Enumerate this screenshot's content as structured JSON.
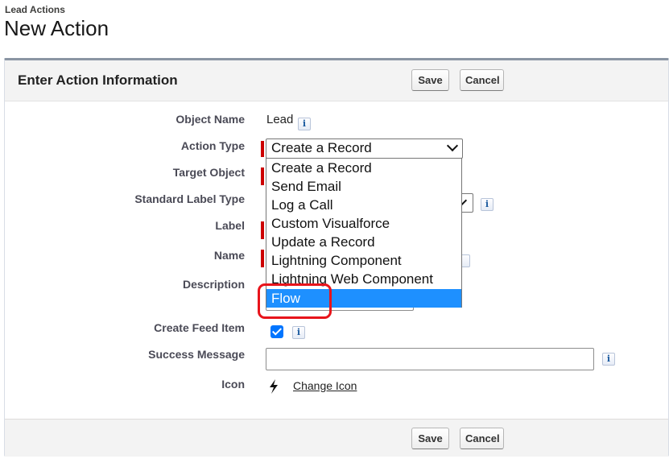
{
  "header": {
    "breadcrumb": "Lead Actions",
    "title": "New Action"
  },
  "section": {
    "title": "Enter Action Information"
  },
  "buttons": {
    "save": "Save",
    "cancel": "Cancel"
  },
  "fields": {
    "object_name": {
      "label": "Object Name",
      "value": "Lead"
    },
    "action_type": {
      "label": "Action Type",
      "value": "Create a Record"
    },
    "target_object": {
      "label": "Target Object"
    },
    "standard_label_type": {
      "label": "Standard Label Type"
    },
    "label": {
      "label": "Label"
    },
    "name": {
      "label": "Name"
    },
    "description": {
      "label": "Description"
    },
    "create_feed_item": {
      "label": "Create Feed Item",
      "checked": true
    },
    "success_message": {
      "label": "Success Message",
      "value": ""
    },
    "icon": {
      "label": "Icon",
      "link": "Change Icon",
      "icon_name": "lightning-bolt-icon"
    }
  },
  "dropdown": {
    "options": [
      "Create a Record",
      "Send Email",
      "Log a Call",
      "Custom Visualforce",
      "Update a Record",
      "Lightning Component",
      "Lightning Web Component",
      "Flow"
    ],
    "highlighted": "Flow"
  },
  "colors": {
    "required": "#cc0000",
    "selected_option": "#1e90ff",
    "highlight_box": "#e8141b"
  },
  "info_glyph": "i"
}
